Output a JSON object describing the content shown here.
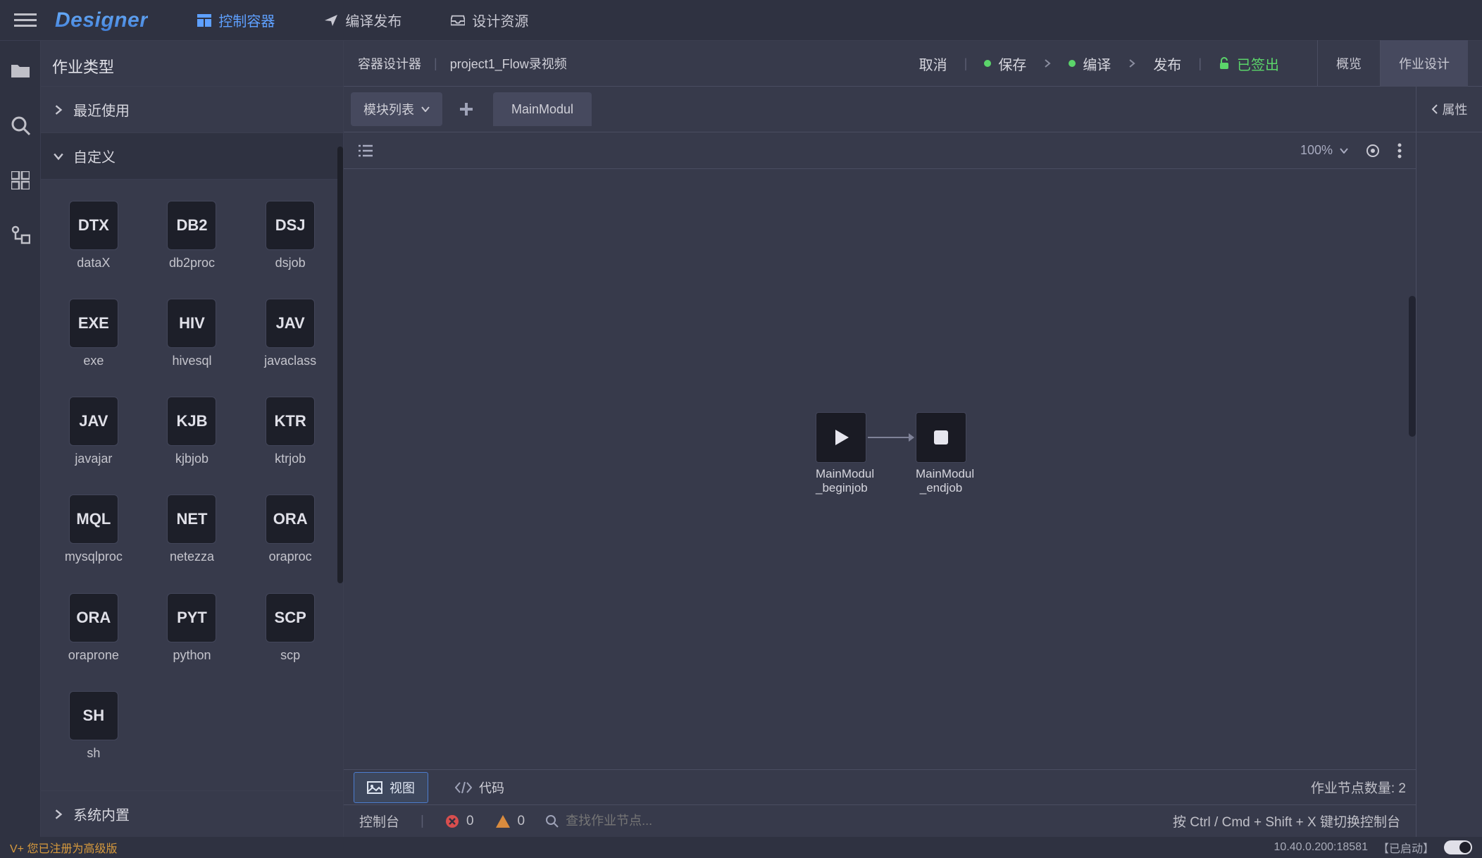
{
  "topbar": {
    "logo": "Designer",
    "tabs": [
      {
        "label": "控制容器",
        "active": true
      },
      {
        "label": "编译发布",
        "active": false
      },
      {
        "label": "设计资源",
        "active": false
      }
    ]
  },
  "sidepanel": {
    "title": "作业类型",
    "sections": {
      "recent": "最近使用",
      "custom": "自定义",
      "system": "系统内置"
    },
    "jobTypes": [
      {
        "badge": "DTX",
        "label": "dataX"
      },
      {
        "badge": "DB2",
        "label": "db2proc"
      },
      {
        "badge": "DSJ",
        "label": "dsjob"
      },
      {
        "badge": "EXE",
        "label": "exe"
      },
      {
        "badge": "HIV",
        "label": "hivesql"
      },
      {
        "badge": "JAV",
        "label": "javaclass"
      },
      {
        "badge": "JAV",
        "label": "javajar"
      },
      {
        "badge": "KJB",
        "label": "kjbjob"
      },
      {
        "badge": "KTR",
        "label": "ktrjob"
      },
      {
        "badge": "MQL",
        "label": "mysqlproc"
      },
      {
        "badge": "NET",
        "label": "netezza"
      },
      {
        "badge": "ORA",
        "label": "oraproc"
      },
      {
        "badge": "ORA",
        "label": "oraprone"
      },
      {
        "badge": "PYT",
        "label": "python"
      },
      {
        "badge": "SCP",
        "label": "scp"
      },
      {
        "badge": "SH",
        "label": "sh"
      }
    ]
  },
  "breadcrumb": {
    "designer": "容器设计器",
    "project": "project1_Flow录视频",
    "actions": {
      "cancel": "取消",
      "save": "保存",
      "compile": "编译",
      "publish": "发布",
      "checkedOut": "已签出"
    },
    "views": {
      "overview": "概览",
      "jobDesign": "作业设计"
    }
  },
  "tabbar": {
    "moduleList": "模块列表",
    "activeTab": "MainModul"
  },
  "canvasbar": {
    "zoom": "100%"
  },
  "canvas": {
    "nodes": {
      "begin": {
        "line1": "MainModul",
        "line2": "_beginjob"
      },
      "end": {
        "line1": "MainModul",
        "line2": "_endjob"
      }
    }
  },
  "viewbar": {
    "view": "视图",
    "code": "代码",
    "countLabel": "作业节点数量:",
    "countValue": "2"
  },
  "console": {
    "label": "控制台",
    "errors": "0",
    "warnings": "0",
    "searchPlaceholder": "查找作业节点...",
    "hint": "按 Ctrl / Cmd + Shift + X 键切换控制台"
  },
  "rightpanel": {
    "props": "属性"
  },
  "statusbar": {
    "vplus": "V+ 您已注册为高级版",
    "host": "10.40.0.200:18581",
    "state": "【已启动】"
  }
}
